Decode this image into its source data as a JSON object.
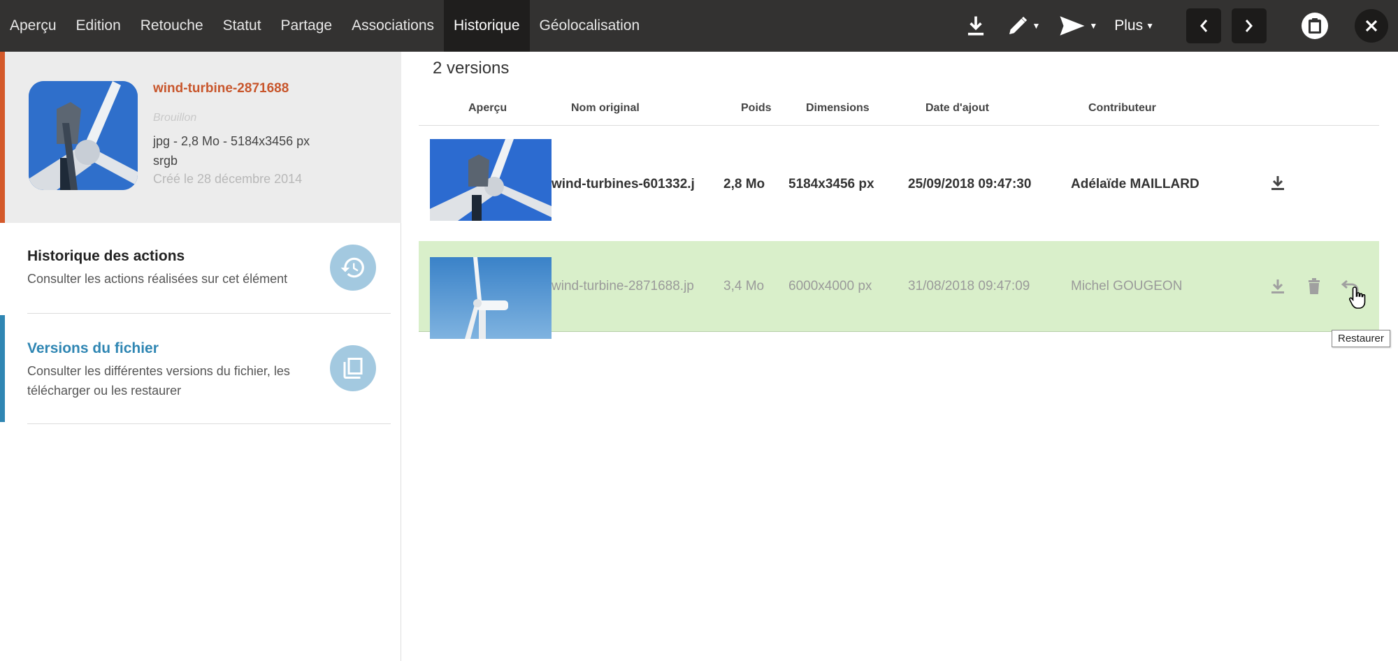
{
  "topbar": {
    "tabs": [
      {
        "label": "Aperçu",
        "active": false
      },
      {
        "label": "Edition",
        "active": false
      },
      {
        "label": "Retouche",
        "active": false
      },
      {
        "label": "Statut",
        "active": false
      },
      {
        "label": "Partage",
        "active": false
      },
      {
        "label": "Associations",
        "active": false
      },
      {
        "label": "Historique",
        "active": true
      },
      {
        "label": "Géolocalisation",
        "active": false
      }
    ],
    "plus_label": "Plus",
    "icons": [
      "download-icon",
      "pencil-icon",
      "send-icon",
      "chevron-left-icon",
      "chevron-right-icon",
      "clipboard-icon",
      "close-icon"
    ]
  },
  "file": {
    "title": "wind-turbine-2871688",
    "status": "Brouillon",
    "meta_line1": "jpg - 2,8 Mo - 5184x3456 px",
    "meta_line2": "srgb",
    "created": "Créé le 28 décembre 2014"
  },
  "sections": [
    {
      "title": "Historique des actions",
      "description": "Consulter les actions réalisées sur cet élément",
      "icon": "history-icon"
    },
    {
      "title": "Versions du fichier",
      "description": "Consulter les différentes versions du fichier, les télécharger ou les restaurer",
      "icon": "layers-icon",
      "active": true
    }
  ],
  "versions": {
    "count_label": "2 versions",
    "columns": [
      "Aperçu",
      "Nom original",
      "Poids",
      "Dimensions",
      "Date d'ajout",
      "Contributeur"
    ],
    "rows": [
      {
        "name": "wind-turbines-601332.j",
        "size": "2,8 Mo",
        "dimensions": "5184x3456 px",
        "date": "25/09/2018 09:47:30",
        "contributor": "Adélaïde MAILLARD",
        "actions": [
          "download-icon"
        ]
      },
      {
        "name": "wind-turbine-2871688.jp",
        "size": "3,4 Mo",
        "dimensions": "6000x4000 px",
        "date": "31/08/2018 09:47:09",
        "contributor": "Michel GOUGEON",
        "actions": [
          "download-icon",
          "trash-icon",
          "restore-icon"
        ]
      }
    ],
    "tooltip": "Restaurer"
  },
  "colors": {
    "topbar": "#333231",
    "accent_orange": "#c8562c",
    "accent_blue": "#2f86b3",
    "row_highlight": "#d9efca"
  }
}
